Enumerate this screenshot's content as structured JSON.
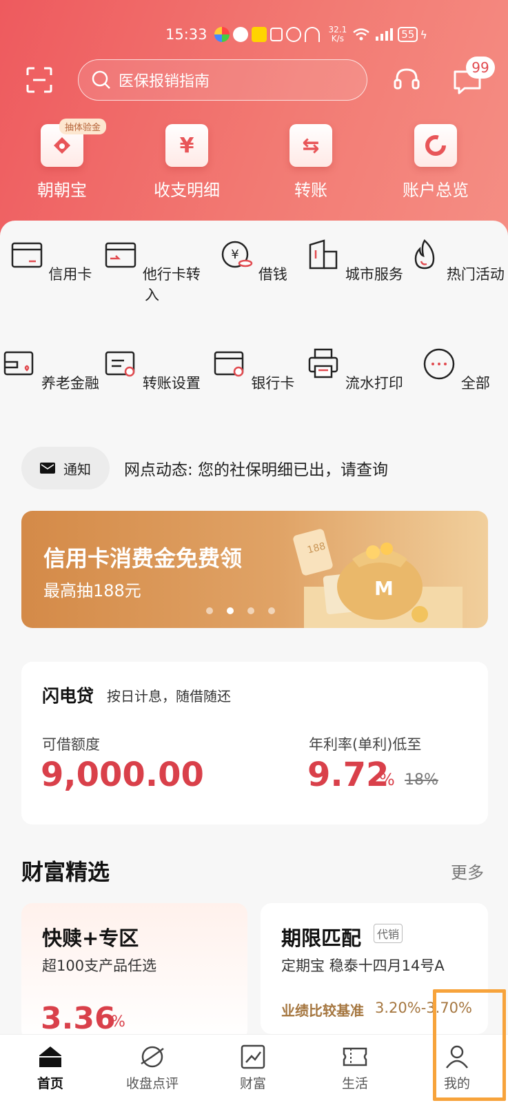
{
  "status_bar": {
    "time": "15:33",
    "net_speed": "32.1",
    "net_unit": "K/s",
    "battery": "55"
  },
  "header": {
    "search_placeholder": "医保报销指南",
    "message_badge": "99"
  },
  "quick_actions": [
    {
      "label": "朝朝宝",
      "tag": "抽体验金"
    },
    {
      "label": "收支明细",
      "glyph": "¥"
    },
    {
      "label": "转账",
      "glyph": "⇆"
    },
    {
      "label": "账户总览"
    }
  ],
  "services": [
    {
      "label": "信用卡"
    },
    {
      "label": "他行卡转入"
    },
    {
      "label": "借钱",
      "glyph": "¥"
    },
    {
      "label": "城市服务"
    },
    {
      "label": "热门活动"
    },
    {
      "label": "养老金融"
    },
    {
      "label": "转账设置"
    },
    {
      "label": "银行卡"
    },
    {
      "label": "流水打印"
    },
    {
      "label": "全部",
      "glyph": "···"
    }
  ],
  "notice": {
    "tag": "通知",
    "text": "网点动态: 您的社保明细已出，请查询"
  },
  "banner": {
    "title": "信用卡消费金免费领",
    "subtitle": "最高抽188元",
    "badge": "188",
    "active_index": 1
  },
  "loan": {
    "title": "闪电贷",
    "desc": "按日计息，随借随还",
    "limit_label": "可借额度",
    "limit_value": "9,000.00",
    "rate_label": "年利率(单利)低至",
    "rate_value": "9.72",
    "rate_unit": "%",
    "rate_old": "18%"
  },
  "wealth": {
    "title": "财富精选",
    "more": "更多",
    "cards": [
      {
        "title": "快赎+专区",
        "subtitle": "超100支产品任选",
        "rate": "3.36",
        "rate_unit": "%"
      },
      {
        "title": "期限匹配",
        "tag": "代销",
        "subtitle": "定期宝  稳泰十四月14号A",
        "bench_label": "业绩比较基准",
        "bench_value": "3.20%-3.70%"
      }
    ]
  },
  "tabbar": [
    {
      "label": "首页"
    },
    {
      "label": "收盘点评"
    },
    {
      "label": "财富"
    },
    {
      "label": "生活"
    },
    {
      "label": "我的"
    }
  ],
  "colors": {
    "brand": "#ee5a5e",
    "accent_red": "#d9404a",
    "gold": "#a5763f",
    "highlight": "#f7a33b"
  }
}
